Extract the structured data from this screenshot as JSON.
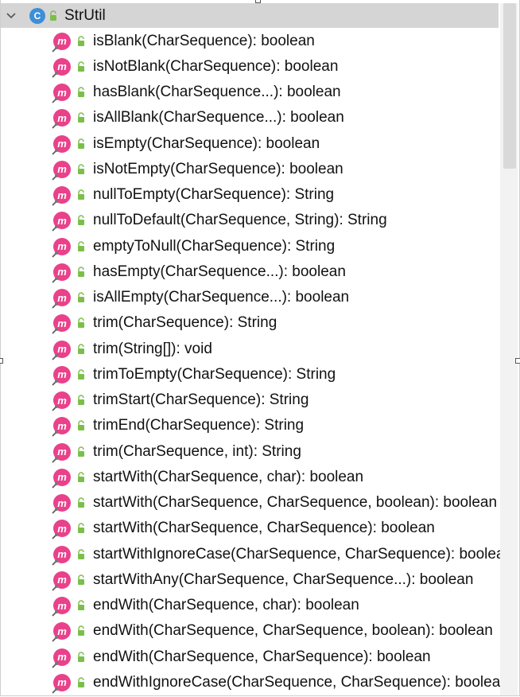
{
  "tree": {
    "class_name": "StrUtil",
    "class_icon_letter": "C",
    "method_icon_letter": "m",
    "methods": [
      "isBlank(CharSequence): boolean",
      "isNotBlank(CharSequence): boolean",
      "hasBlank(CharSequence...): boolean",
      "isAllBlank(CharSequence...): boolean",
      "isEmpty(CharSequence): boolean",
      "isNotEmpty(CharSequence): boolean",
      "nullToEmpty(CharSequence): String",
      "nullToDefault(CharSequence, String): String",
      "emptyToNull(CharSequence): String",
      "hasEmpty(CharSequence...): boolean",
      "isAllEmpty(CharSequence...): boolean",
      "trim(CharSequence): String",
      "trim(String[]): void",
      "trimToEmpty(CharSequence): String",
      "trimStart(CharSequence): String",
      "trimEnd(CharSequence): String",
      "trim(CharSequence, int): String",
      "startWith(CharSequence, char): boolean",
      "startWith(CharSequence, CharSequence, boolean): boolean",
      "startWith(CharSequence, CharSequence): boolean",
      "startWithIgnoreCase(CharSequence, CharSequence): boolean",
      "startWithAny(CharSequence, CharSequence...): boolean",
      "endWith(CharSequence, char): boolean",
      "endWith(CharSequence, CharSequence, boolean): boolean",
      "endWith(CharSequence, CharSequence): boolean",
      "endWithIgnoreCase(CharSequence, CharSequence): boolean"
    ]
  },
  "icons": {
    "expand": "chevron-down-icon",
    "class": "class-icon",
    "method": "method-icon",
    "visibility": "public-lock-icon"
  },
  "colors": {
    "class_icon": "#3d8fd6",
    "method_icon": "#e9418a",
    "public_lock": "#7bbf4a",
    "selected_row": "#d5d5d5"
  }
}
